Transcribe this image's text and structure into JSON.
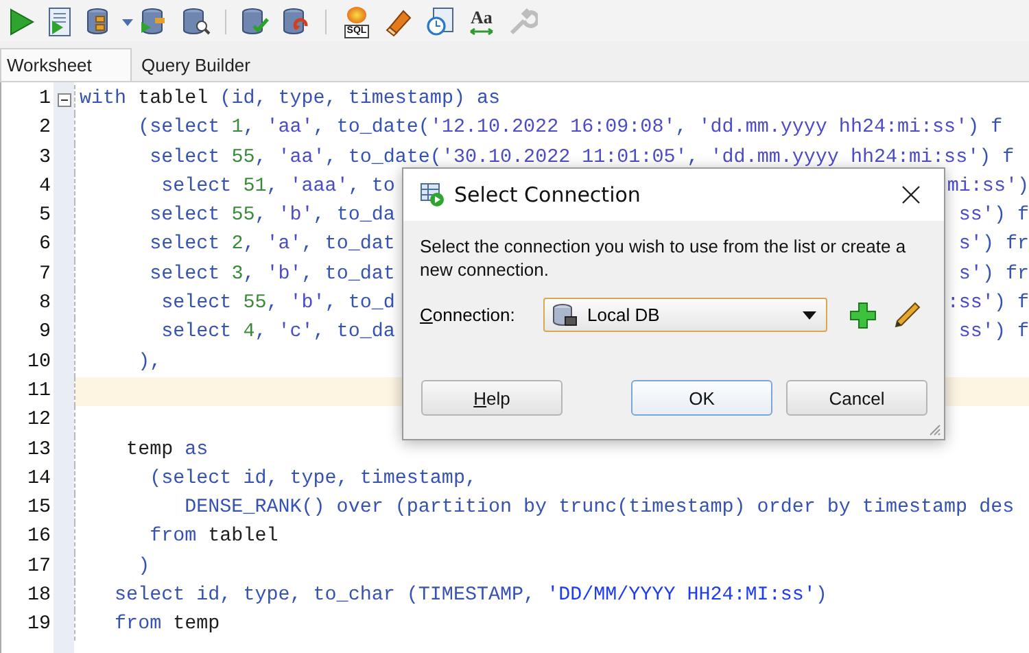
{
  "toolbar": [
    [
      {
        "kind": "run",
        "disabled": false
      },
      {
        "kind": "run-script",
        "disabled": false
      },
      {
        "kind": "db-tree",
        "disabled": false
      },
      {
        "kind": "caret",
        "disabled": false
      },
      {
        "kind": "db-run",
        "disabled": false
      },
      {
        "kind": "db-search",
        "disabled": false
      }
    ],
    [
      {
        "kind": "commit",
        "disabled": false
      },
      {
        "kind": "rollback",
        "disabled": false
      }
    ],
    [
      {
        "kind": "sql",
        "label": "SQL",
        "disabled": false
      },
      {
        "kind": "eraser",
        "disabled": false
      },
      {
        "kind": "history",
        "disabled": false
      },
      {
        "kind": "format",
        "label": "Aa",
        "disabled": false
      },
      {
        "kind": "tools",
        "disabled": true
      }
    ]
  ],
  "tabs": [
    {
      "label": "Worksheet",
      "selected": true
    },
    {
      "label": "Query Builder",
      "selected": false
    }
  ],
  "editor": {
    "lines": [
      {
        "number": "1",
        "current": false,
        "expanded": true,
        "tokens": [
          {
            "text": "with ",
            "kind": "kw"
          },
          {
            "text": "tablel",
            "kind": "name"
          },
          {
            "text": " (id, type, timestamp) as",
            "kind": "kw"
          }
        ]
      },
      {
        "number": "2",
        "current": false,
        "tokens": [
          {
            "text": "     (select ",
            "kind": "kw"
          },
          {
            "text": "1",
            "kind": "num"
          },
          {
            "text": ", ",
            "kind": "kw"
          },
          {
            "text": "'aa'",
            "kind": "str"
          },
          {
            "text": ", to_date(",
            "kind": "kw"
          },
          {
            "text": "'12.10.2022 16:09:08'",
            "kind": "str"
          },
          {
            "text": ", ",
            "kind": "kw"
          },
          {
            "text": "'dd.mm.yyyy hh24:mi:ss'",
            "kind": "str"
          },
          {
            "text": ") f",
            "kind": "kw"
          }
        ]
      },
      {
        "number": "3",
        "current": false,
        "tokens": [
          {
            "text": "      select ",
            "kind": "kw"
          },
          {
            "text": "55",
            "kind": "num"
          },
          {
            "text": ", ",
            "kind": "kw"
          },
          {
            "text": "'aa'",
            "kind": "str"
          },
          {
            "text": ", to_date(",
            "kind": "kw"
          },
          {
            "text": "'30.10.2022 11:01:05'",
            "kind": "str"
          },
          {
            "text": ", ",
            "kind": "kw"
          },
          {
            "text": "'dd.mm.yyyy hh24:mi:ss'",
            "kind": "str"
          },
          {
            "text": ") f",
            "kind": "kw"
          }
        ]
      },
      {
        "number": "4",
        "current": false,
        "tokens": [
          {
            "text": "       select ",
            "kind": "kw"
          },
          {
            "text": "51",
            "kind": "num"
          },
          {
            "text": ", ",
            "kind": "kw"
          },
          {
            "text": "'aaa'",
            "kind": "str"
          },
          {
            "text": ", to",
            "kind": "kw"
          }
        ],
        "tail": [
          {
            "text": "mi:ss'",
            "kind": "str"
          },
          {
            "text": ")",
            "kind": "kw"
          }
        ]
      },
      {
        "number": "5",
        "current": false,
        "tokens": [
          {
            "text": "      select ",
            "kind": "kw"
          },
          {
            "text": "55",
            "kind": "num"
          },
          {
            "text": ", ",
            "kind": "kw"
          },
          {
            "text": "'b'",
            "kind": "str"
          },
          {
            "text": ", to_da",
            "kind": "kw"
          }
        ],
        "tail": [
          {
            "text": "ss'",
            "kind": "str"
          },
          {
            "text": ") f",
            "kind": "kw"
          }
        ]
      },
      {
        "number": "6",
        "current": false,
        "tokens": [
          {
            "text": "      select ",
            "kind": "kw"
          },
          {
            "text": "2",
            "kind": "num"
          },
          {
            "text": ", ",
            "kind": "kw"
          },
          {
            "text": "'a'",
            "kind": "str"
          },
          {
            "text": ", to_dat",
            "kind": "kw"
          }
        ],
        "tail": [
          {
            "text": "s'",
            "kind": "str"
          },
          {
            "text": ") fr",
            "kind": "kw"
          }
        ]
      },
      {
        "number": "7",
        "current": false,
        "tokens": [
          {
            "text": "      select ",
            "kind": "kw"
          },
          {
            "text": "3",
            "kind": "num"
          },
          {
            "text": ", ",
            "kind": "kw"
          },
          {
            "text": "'b'",
            "kind": "str"
          },
          {
            "text": ", to_dat",
            "kind": "kw"
          }
        ],
        "tail": [
          {
            "text": "s'",
            "kind": "str"
          },
          {
            "text": ") fr",
            "kind": "kw"
          }
        ]
      },
      {
        "number": "8",
        "current": false,
        "tokens": [
          {
            "text": "       select ",
            "kind": "kw"
          },
          {
            "text": "55",
            "kind": "num"
          },
          {
            "text": ", ",
            "kind": "kw"
          },
          {
            "text": "'b'",
            "kind": "str"
          },
          {
            "text": ", to_d",
            "kind": "kw"
          }
        ],
        "tail": [
          {
            "text": ":ss'",
            "kind": "str"
          },
          {
            "text": ") f",
            "kind": "kw"
          }
        ]
      },
      {
        "number": "9",
        "current": false,
        "tokens": [
          {
            "text": "       select ",
            "kind": "kw"
          },
          {
            "text": "4",
            "kind": "num"
          },
          {
            "text": ", ",
            "kind": "kw"
          },
          {
            "text": "'c'",
            "kind": "str"
          },
          {
            "text": ", to_da",
            "kind": "kw"
          }
        ],
        "tail": [
          {
            "text": "ss'",
            "kind": "str"
          },
          {
            "text": ") f",
            "kind": "kw"
          }
        ]
      },
      {
        "number": "10",
        "current": false,
        "tokens": [
          {
            "text": "     ),",
            "kind": "kw"
          }
        ]
      },
      {
        "number": "11",
        "current": true
      },
      {
        "number": "12",
        "current": false
      },
      {
        "number": "13",
        "current": false,
        "tokens": [
          {
            "text": "    temp",
            "kind": "name"
          },
          {
            "text": " as",
            "kind": "kw"
          }
        ]
      },
      {
        "number": "14",
        "current": false,
        "tokens": [
          {
            "text": "      (select id, type, timestamp,",
            "kind": "kw"
          }
        ]
      },
      {
        "number": "15",
        "current": false,
        "tokens": [
          {
            "text": "         DENSE_RANK() over (partition by trunc(timestamp) order by timestamp des",
            "kind": "kw"
          }
        ]
      },
      {
        "number": "16",
        "current": false,
        "tokens": [
          {
            "text": "      from ",
            "kind": "kw"
          },
          {
            "text": "tablel",
            "kind": "name"
          }
        ]
      },
      {
        "number": "17",
        "current": false,
        "tokens": [
          {
            "text": "     )",
            "kind": "kw"
          }
        ]
      },
      {
        "number": "18",
        "current": false,
        "tokens": [
          {
            "text": "   select id, type, to_char (TIMESTAMP, ",
            "kind": "kw"
          },
          {
            "text": "'DD/MM/YYYY HH24:MI:ss'",
            "kind": "lit"
          },
          {
            "text": ")",
            "kind": "kw"
          }
        ]
      },
      {
        "number": "19",
        "current": false,
        "tokens": [
          {
            "text": "   from ",
            "kind": "kw"
          },
          {
            "text": "temp",
            "kind": "name"
          }
        ]
      }
    ]
  },
  "dialog": {
    "title": "Select Connection",
    "message": "Select the connection you wish to use from the list or create a new connection.",
    "connection": {
      "label": "Connection:",
      "value": "Local DB"
    },
    "buttons": [
      {
        "label": "Help",
        "default": false
      },
      {
        "label": "OK",
        "default": true
      },
      {
        "label": "Cancel",
        "default": false
      }
    ]
  }
}
